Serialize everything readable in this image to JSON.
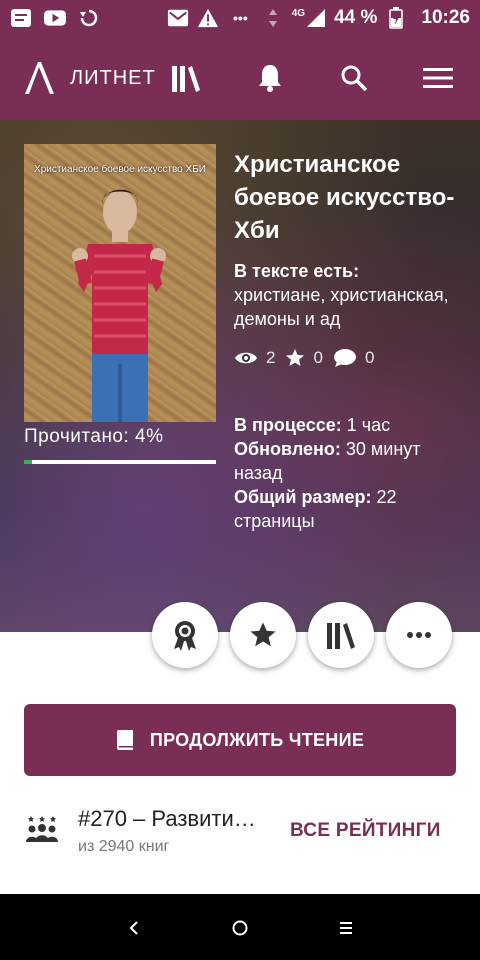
{
  "status_bar": {
    "battery_text": "44 %",
    "network_text": "4G",
    "time": "10:26",
    "dots": "•••"
  },
  "toolbar": {
    "logo_text": "ЛИТНЕТ"
  },
  "book": {
    "cover_title": "Христианское боевое искусство ХБИ",
    "title": "Христианское боевое искусство- Хби",
    "tags_label": "В тексте есть:",
    "tags": "христиане, христианская, демоны и ад",
    "views": "2",
    "likes": "0",
    "comments": "0",
    "read_label": "Прочитано: 4%",
    "read_progress": 0.04,
    "status_label": "В процессе:",
    "status_value": " 1 час",
    "updated_label": "Обновлено:",
    "updated_value": " 30 минут назад",
    "size_label": "Общий размер:",
    "size_value": " 22 страницы"
  },
  "actions": {
    "continue_label": "ПРОДОЛЖИТЬ ЧТЕНИЕ"
  },
  "rating": {
    "main": "#270 – Развити…",
    "sub": "из 2940 книг",
    "link": "ВСЕ РЕЙТИНГИ"
  },
  "colors": {
    "brand": "#7a2d55",
    "progress": "#37b24d"
  }
}
